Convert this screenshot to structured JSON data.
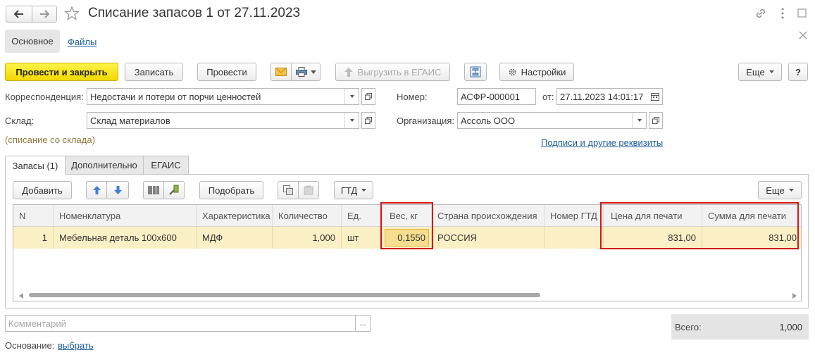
{
  "window": {
    "title": "Списание запасов 1 от 27.11.2023"
  },
  "nav_tabs": {
    "main": "Основное",
    "files": "Файлы"
  },
  "toolbar": {
    "post_and_close": "Провести и закрыть",
    "save": "Записать",
    "post": "Провести",
    "export_egais": "Выгрузить в ЕГАИС",
    "settings": "Настройки",
    "more": "Еще",
    "help": "?"
  },
  "header": {
    "correspondence_label": "Корреспонденция:",
    "correspondence_value": "Недостачи и потери от порчи ценностей",
    "warehouse_label": "Склад:",
    "warehouse_value": "Склад материалов",
    "writeoff_note": "(списание со склада)",
    "number_label": "Номер:",
    "number_value": "АСФР-000001",
    "date_label": "от:",
    "date_value": "27.11.2023 14:01:17",
    "org_label": "Организация:",
    "org_value": "Ассоль ООО",
    "signatures_link": "Подписи и другие реквизиты"
  },
  "doc_tabs": [
    "Запасы (1)",
    "Дополнительно",
    "ЕГАИС"
  ],
  "table_toolbar": {
    "add": "Добавить",
    "pick": "Подобрать",
    "gtd": "ГТД",
    "more": "Еще"
  },
  "table": {
    "columns": [
      "N",
      "Номенклатура",
      "Характеристика",
      "Количество",
      "Ед.",
      "Вес, кг",
      "Страна происхождения",
      "Номер ГТД",
      "Цена для печати",
      "Сумма для печати"
    ],
    "rows": [
      {
        "n": "1",
        "nomenclature": "Мебельная деталь 100х600",
        "characteristic": "МДФ",
        "quantity": "1,000",
        "unit": "шт",
        "weight": "0,1550",
        "country": "РОССИЯ",
        "gtd": "",
        "print_price": "831,00",
        "print_sum": "831,00"
      }
    ]
  },
  "footer": {
    "comment_placeholder": "Комментарий",
    "total_label": "Всего:",
    "total_value": "1,000",
    "basis_label": "Основание:",
    "basis_link": "выбрать"
  },
  "colors": {
    "primary_button": "#f5de00",
    "highlight_box": "#d2171b",
    "row_selected": "#fbefc5",
    "link": "#1b5c9e"
  }
}
